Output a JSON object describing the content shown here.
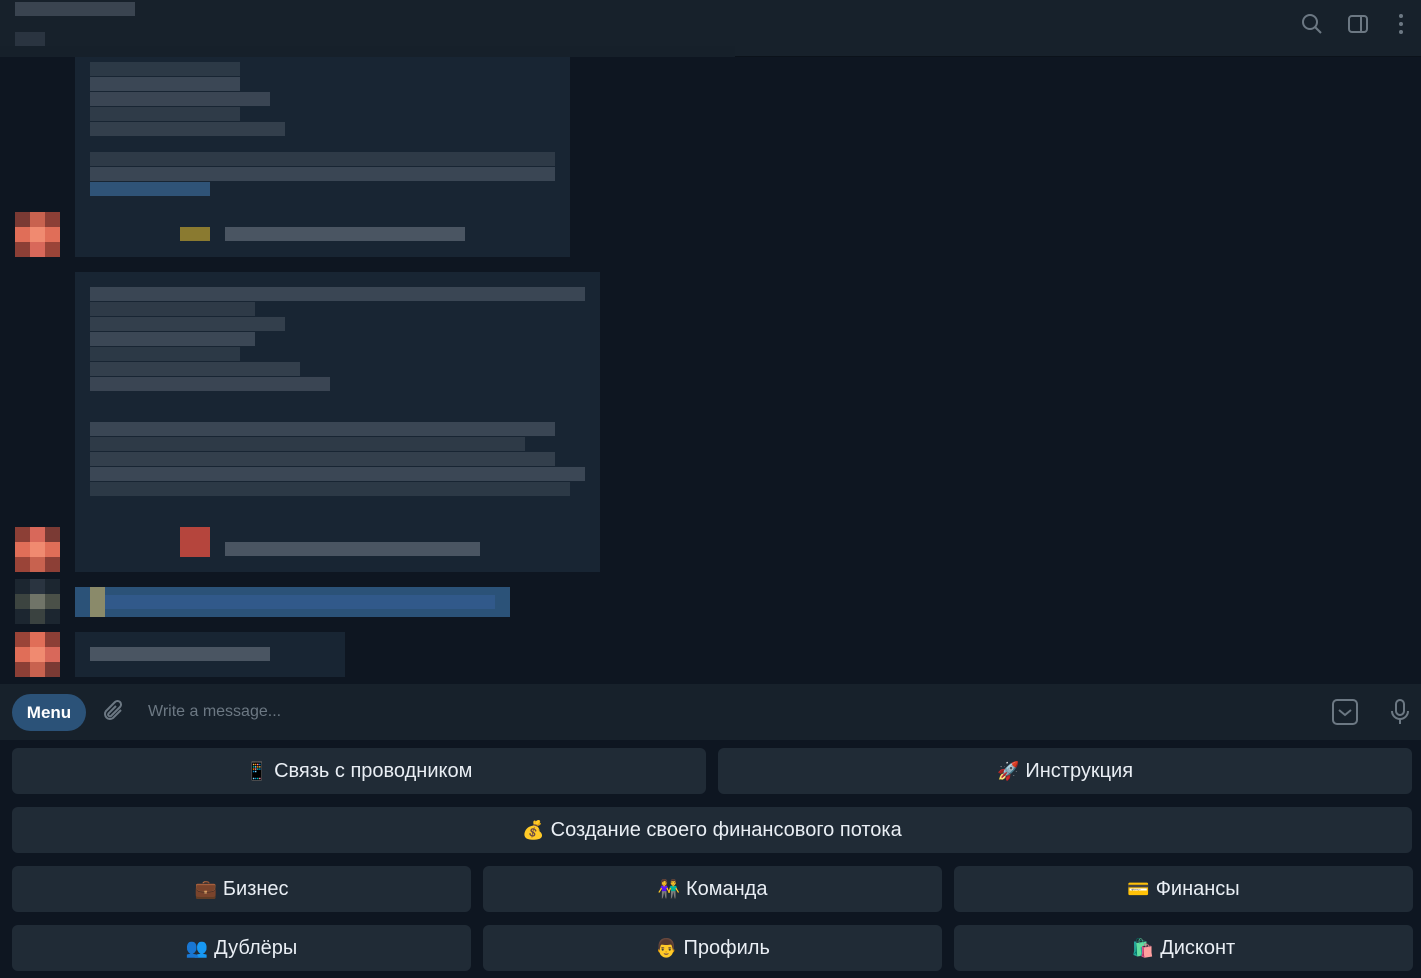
{
  "header": {
    "icons": [
      "search-icon",
      "sidebar-toggle-icon",
      "more-vertical-icon"
    ]
  },
  "composer": {
    "menu_label": "Menu",
    "placeholder": "Write a message...",
    "icons": [
      "paperclip-icon",
      "bot-keyboard-icon",
      "microphone-icon"
    ]
  },
  "keyboard": {
    "buttons": [
      {
        "emoji": "📱",
        "label": "Связь с проводником"
      },
      {
        "emoji": "🚀",
        "label": "Инструкция"
      },
      {
        "emoji": "💰",
        "label": "Создание своего финансового потока"
      },
      {
        "emoji": "💼",
        "label": "Бизнес"
      },
      {
        "emoji": "👫",
        "label": "Команда"
      },
      {
        "emoji": "💳",
        "label": "Финансы"
      },
      {
        "emoji": "👥",
        "label": "Дублёры"
      },
      {
        "emoji": "👨",
        "label": "Профиль"
      },
      {
        "emoji": "🛍️",
        "label": "Дисконт"
      }
    ]
  },
  "colors": {
    "background": "#0e1621",
    "panel": "#17212b",
    "bubble": "#182533",
    "button": "#202b36",
    "accent": "#2b5278",
    "icon": "#6c7883"
  }
}
